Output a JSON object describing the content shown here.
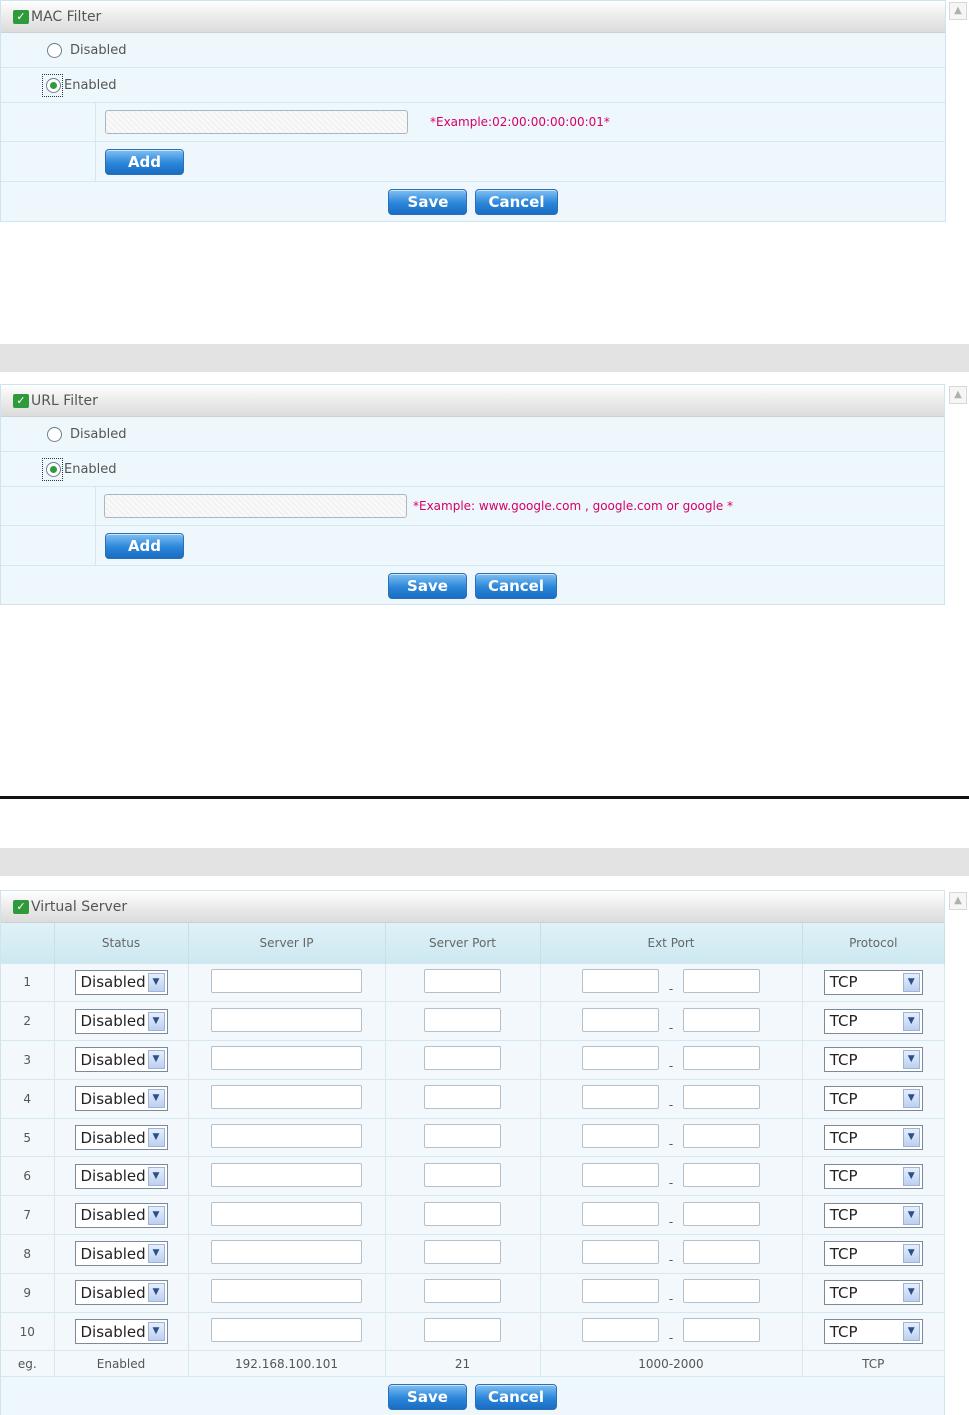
{
  "mac_filter": {
    "title": "MAC Filter",
    "options": [
      "Disabled",
      "Enabled"
    ],
    "selected": "Enabled",
    "input_value": "",
    "hint": "*Example:02:00:00:00:00:01*",
    "add_label": "Add",
    "save_label": "Save",
    "cancel_label": "Cancel"
  },
  "url_filter": {
    "title": "URL Filter",
    "options": [
      "Disabled",
      "Enabled"
    ],
    "selected": "Enabled",
    "input_value": "",
    "hint": "*Example: www.google.com , google.com or google *",
    "add_label": "Add",
    "save_label": "Save",
    "cancel_label": "Cancel"
  },
  "virtual_server": {
    "title": "Virtual Server",
    "columns": [
      "",
      "Status",
      "Server IP",
      "Server Port",
      "Ext Port",
      "Protocol"
    ],
    "rows": [
      {
        "num": "1",
        "status": "Disabled",
        "protocol": "TCP"
      },
      {
        "num": "2",
        "status": "Disabled",
        "protocol": "TCP"
      },
      {
        "num": "3",
        "status": "Disabled",
        "protocol": "TCP"
      },
      {
        "num": "4",
        "status": "Disabled",
        "protocol": "TCP"
      },
      {
        "num": "5",
        "status": "Disabled",
        "protocol": "TCP"
      },
      {
        "num": "6",
        "status": "Disabled",
        "protocol": "TCP"
      },
      {
        "num": "7",
        "status": "Disabled",
        "protocol": "TCP"
      },
      {
        "num": "8",
        "status": "Disabled",
        "protocol": "TCP"
      },
      {
        "num": "9",
        "status": "Disabled",
        "protocol": "TCP"
      },
      {
        "num": "10",
        "status": "Disabled",
        "protocol": "TCP"
      }
    ],
    "example": {
      "num": "eg.",
      "status": "Enabled",
      "server_ip": "192.168.100.101",
      "server_port": "21",
      "ext_port": "1000-2000",
      "protocol": "TCP"
    },
    "ext_port_separator": "-",
    "save_label": "Save",
    "cancel_label": "Cancel"
  },
  "icons": {
    "section_icon": "green-check-icon",
    "scroll_up": "scroll-up-arrow-icon",
    "dropdown": "chevron-down-icon"
  }
}
